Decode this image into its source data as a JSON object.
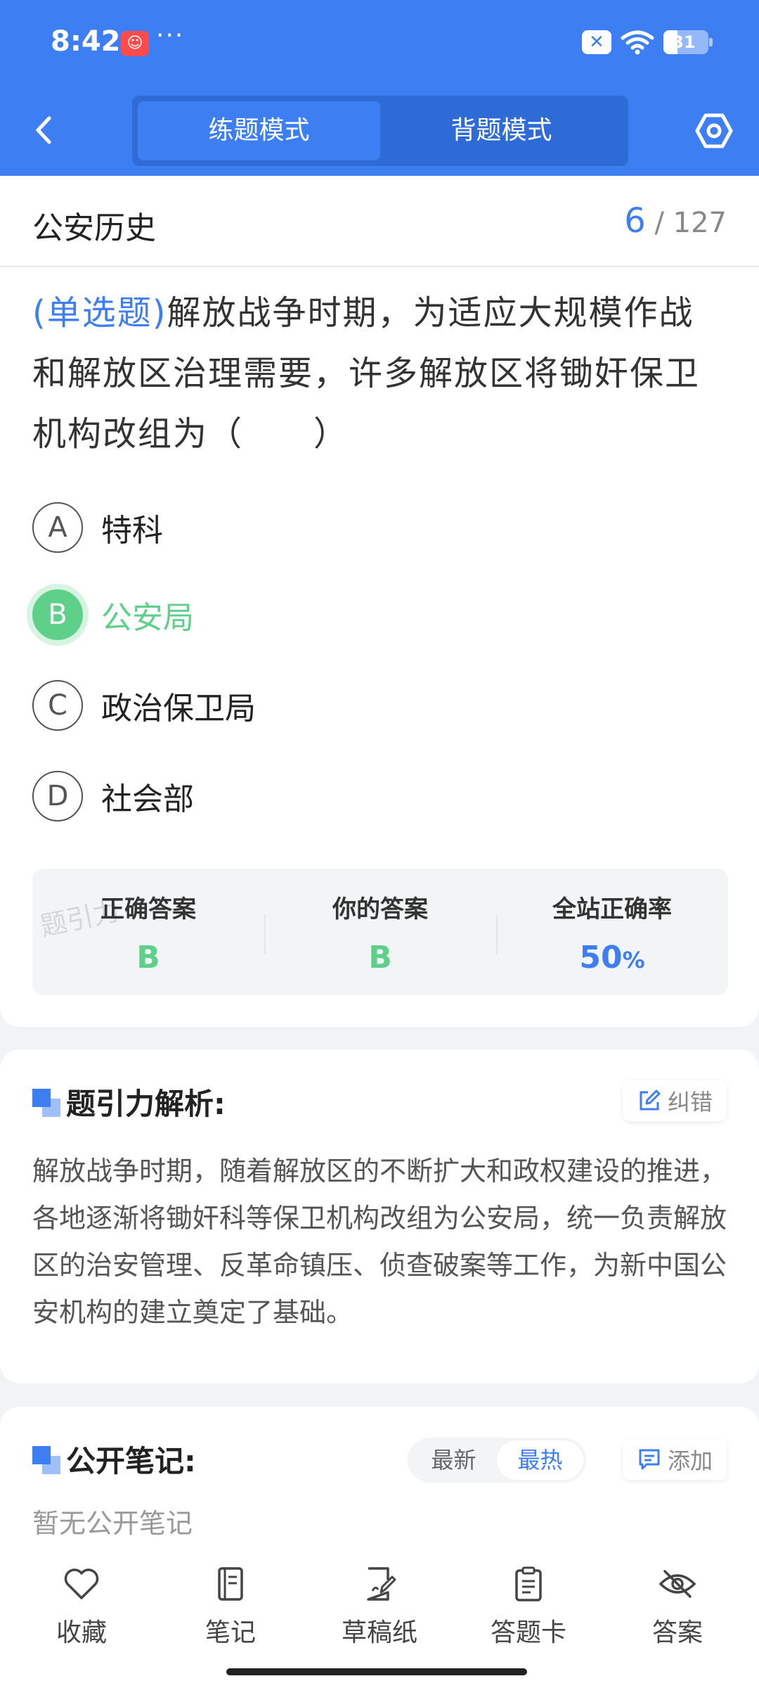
{
  "status": {
    "time": "8:42",
    "dots": "···",
    "battery": "31"
  },
  "header": {
    "tabs": [
      "练题模式",
      "背题模式"
    ],
    "active_tab": 0
  },
  "question": {
    "subject": "公安历史",
    "current": "6",
    "total": "/ 127",
    "type": "(单选题)",
    "text": "解放战争时期，为适应大规模作战和解放区治理需要，许多解放区将锄奸保卫机构改组为（　　）",
    "options": [
      {
        "letter": "A",
        "text": "特科"
      },
      {
        "letter": "B",
        "text": "公安局"
      },
      {
        "letter": "C",
        "text": "政治保卫局"
      },
      {
        "letter": "D",
        "text": "社会部"
      }
    ],
    "selected": "B"
  },
  "stats": {
    "correct_label": "正确答案",
    "correct_value": "B",
    "yours_label": "你的答案",
    "yours_value": "B",
    "rate_label": "全站正确率",
    "rate_value": "50",
    "rate_unit": "%",
    "watermark": "题引力"
  },
  "analysis": {
    "title": "题引力解析:",
    "report_label": "纠错",
    "text": "解放战争时期，随着解放区的不断扩大和政权建设的推进，各地逐渐将锄奸科等保卫机构改组为公安局，统一负责解放区的治安管理、反革命镇压、侦查破案等工作，为新中国公安机构的建立奠定了基础。"
  },
  "notes": {
    "title": "公开笔记:",
    "sort_options": [
      "最新",
      "最热"
    ],
    "active_sort": 1,
    "add_label": "添加",
    "empty_text": "暂无公开笔记"
  },
  "bottom_nav": [
    {
      "label": "收藏",
      "icon": "heart-icon"
    },
    {
      "label": "笔记",
      "icon": "notebook-icon"
    },
    {
      "label": "草稿纸",
      "icon": "draft-paper-icon"
    },
    {
      "label": "答题卡",
      "icon": "answer-card-icon"
    },
    {
      "label": "答案",
      "icon": "eye-off-icon"
    }
  ],
  "colors": {
    "primary": "#3d7ff2",
    "correct": "#5fd08a"
  }
}
